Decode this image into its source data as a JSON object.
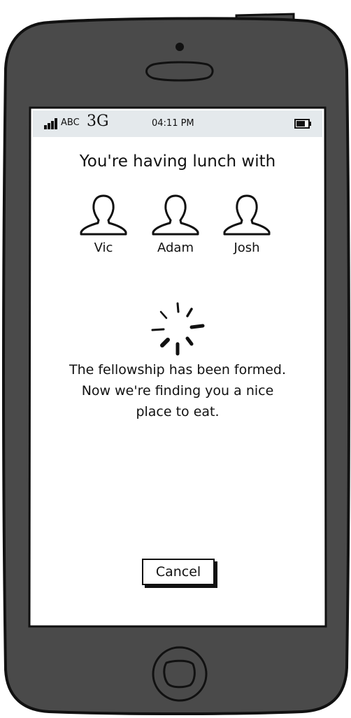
{
  "status_bar": {
    "carrier": "ABC",
    "network": "3G",
    "time": "04:11 PM",
    "icons": [
      "signal-bars-icon",
      "battery-icon"
    ]
  },
  "title": "You're having lunch with",
  "people": [
    {
      "name": "Vic",
      "icon": "person-icon"
    },
    {
      "name": "Adam",
      "icon": "person-icon"
    },
    {
      "name": "Josh",
      "icon": "person-icon"
    }
  ],
  "spinner": {
    "icon": "loading-spinner-icon"
  },
  "message": {
    "line1": "The fellowship has been formed.",
    "line2": "Now we're finding you a nice",
    "line3": "place to eat."
  },
  "cancel_label": "Cancel",
  "colors": {
    "phone_body": "#4a4a4a",
    "outline": "#111111",
    "status_bar": "#e4e9ec",
    "screen": "#ffffff"
  }
}
